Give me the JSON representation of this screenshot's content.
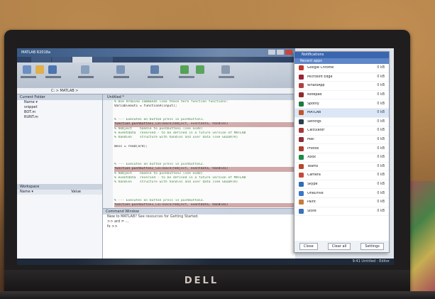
{
  "photo": {
    "brand": "DELL"
  },
  "app": {
    "title": "MATLAB R2018a",
    "address": "C: > MATLAB >",
    "left_panel_title": "Current Folder",
    "files": [
      "Name ▾",
      "snippet",
      "BOT.m",
      "RUNT.m"
    ],
    "workspace_title": "Workspace",
    "workspace_cols": [
      "Name ▾",
      "Value"
    ],
    "editor_tab": "Untitled *",
    "code_lines": [
      {
        "t": "comment",
        "s": "% Use Arduino commands like these here function functions:"
      },
      {
        "t": "code",
        "s": "Variableout1 = functionA(input);"
      },
      {
        "t": "blank",
        "s": ""
      },
      {
        "t": "blank",
        "s": ""
      },
      {
        "t": "comment",
        "s": "% --- Executes on button press in pushbutton1."
      },
      {
        "t": "hl",
        "s": "function pushbutton1_Callback(hObject, eventdata, handles)"
      },
      {
        "t": "comment",
        "s": "% hObject    handle to pushbutton1 (see GCBO)"
      },
      {
        "t": "comment",
        "s": "% eventdata  reserved - to be defined in a future version of MATLAB"
      },
      {
        "t": "comment",
        "s": "% handles    structure with handles and user data (see GUIDATA)"
      },
      {
        "t": "blank",
        "s": ""
      },
      {
        "t": "code",
        "s": "mess = read(ard);"
      },
      {
        "t": "blank",
        "s": ""
      },
      {
        "t": "blank",
        "s": ""
      },
      {
        "t": "blank",
        "s": ""
      },
      {
        "t": "comment",
        "s": "% --- Executes on button press in pushbutton2."
      },
      {
        "t": "hl",
        "s": "function pushbutton2_Callback(hObject, eventdata, handles)"
      },
      {
        "t": "comment",
        "s": "% hObject    handle to pushbutton2 (see GCBO)"
      },
      {
        "t": "comment",
        "s": "% eventdata  reserved - to be defined in a future version of MATLAB"
      },
      {
        "t": "comment",
        "s": "% handles    structure with handles and user data (see GUIDATA)"
      },
      {
        "t": "blank",
        "s": ""
      },
      {
        "t": "blank",
        "s": ""
      },
      {
        "t": "blank",
        "s": ""
      },
      {
        "t": "comment",
        "s": "% --- Executes on button press in pushbutton3."
      },
      {
        "t": "hl",
        "s": "function pushbutton3_Callback(hObject, eventdata, handles)"
      }
    ],
    "command_title": "Command Window",
    "command_lines": [
      "New to MATLAB? See resources for Getting Started.",
      ">> ard = ...",
      "fx >>"
    ]
  },
  "popup": {
    "title": "Notifications",
    "subtitle": "Recent apps",
    "items": [
      {
        "name": "Google Chrome",
        "value": "0 kB",
        "color": "#c0392b"
      },
      {
        "name": "Microsoft Edge",
        "value": "0 kB",
        "color": "#9b2335"
      },
      {
        "name": "WhatsApp",
        "value": "0 kB",
        "color": "#b0413e"
      },
      {
        "name": "Notepad",
        "value": "0 kB",
        "color": "#8e2c2c"
      },
      {
        "name": "Spotify",
        "value": "0 kB",
        "color": "#1f7a3f"
      },
      {
        "name": "MATLAB",
        "value": "0 kB",
        "color": "#c0542b",
        "selected": true
      },
      {
        "name": "Settings",
        "value": "0 kB",
        "color": "#2c3e50"
      },
      {
        "name": "Calculator",
        "value": "0 kB",
        "color": "#a63a3a"
      },
      {
        "name": "Mail",
        "value": "0 kB",
        "color": "#8c2f39"
      },
      {
        "name": "Photos",
        "value": "0 kB",
        "color": "#a83f2c"
      },
      {
        "name": "Xbox",
        "value": "0 kB",
        "color": "#1e8a4c"
      },
      {
        "name": "Teams",
        "value": "0 kB",
        "color": "#b4472f"
      },
      {
        "name": "Camera",
        "value": "0 kB",
        "color": "#c14b3a"
      },
      {
        "name": "Skype",
        "value": "0 kB",
        "color": "#2f6fb3"
      },
      {
        "name": "OneDrive",
        "value": "0 kB",
        "color": "#3a78c4"
      },
      {
        "name": "Paint",
        "value": "0 kB",
        "color": "#c87a3a"
      },
      {
        "name": "Store",
        "value": "0 kB",
        "color": "#3a72b8"
      }
    ],
    "buttons": [
      "Close",
      "Clear all",
      "Settings"
    ]
  },
  "taskbar": {
    "text": "9:41  Untitled - Editor"
  }
}
